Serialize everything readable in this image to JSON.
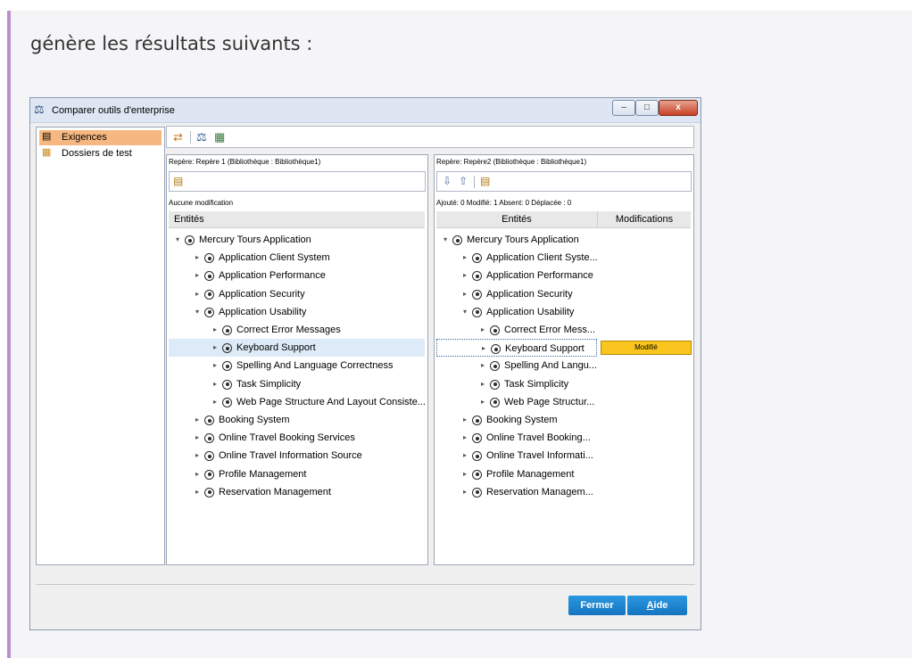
{
  "intro_text": "génère les résultats suivants :",
  "window": {
    "title": "Comparer outils d'enterprise",
    "title_icon": "balance-icon",
    "minimize": "–",
    "maximize": "□",
    "close": "x"
  },
  "sidebar": {
    "items": [
      {
        "label": "Exigences",
        "icon": "requirements-icon",
        "selected": true
      },
      {
        "label": "Dossiers de test",
        "icon": "test-folders-icon",
        "selected": false
      }
    ]
  },
  "toolbar": {
    "icons": [
      "compare-icon",
      "balance-icon",
      "grid-icon"
    ]
  },
  "left_panel": {
    "label": "Repère: Repère 1 (Bibliothèque : Bibliothèque1)",
    "status": "Aucune modification",
    "header_entites": "Entités",
    "tree": [
      {
        "label": "Mercury Tours Application",
        "level": 0,
        "expanded": true
      },
      {
        "label": "Application Client System",
        "level": 1,
        "expanded": false
      },
      {
        "label": "Application Performance",
        "level": 1,
        "expanded": false
      },
      {
        "label": "Application Security",
        "level": 1,
        "expanded": false
      },
      {
        "label": "Application Usability",
        "level": 1,
        "expanded": true
      },
      {
        "label": "Correct Error Messages",
        "level": 2,
        "expanded": false
      },
      {
        "label": "Keyboard Support",
        "level": 2,
        "expanded": false,
        "selected": true
      },
      {
        "label": "Spelling And Language Correctness",
        "level": 2,
        "expanded": false
      },
      {
        "label": "Task Simplicity",
        "level": 2,
        "expanded": false
      },
      {
        "label": "Web Page Structure And Layout Consiste...",
        "level": 2,
        "expanded": false
      },
      {
        "label": "Booking System",
        "level": 1,
        "expanded": false
      },
      {
        "label": "Online Travel Booking Services",
        "level": 1,
        "expanded": false
      },
      {
        "label": "Online Travel Information Source",
        "level": 1,
        "expanded": false
      },
      {
        "label": "Profile Management",
        "level": 1,
        "expanded": false
      },
      {
        "label": "Reservation Management",
        "level": 1,
        "expanded": false
      }
    ]
  },
  "right_panel": {
    "label": "Repère: Repère2 (Bibliothèque : Bibliothèque1)",
    "status": "Ajouté: 0 Modifié: 1 Absent: 0 Déplacée : 0",
    "header_entites": "Entités",
    "header_modifications": "Modifications",
    "tree": [
      {
        "label": "Mercury Tours Application",
        "level": 0,
        "expanded": true
      },
      {
        "label": "Application Client Syste...",
        "level": 1,
        "expanded": false
      },
      {
        "label": "Application Performance",
        "level": 1,
        "expanded": false
      },
      {
        "label": "Application Security",
        "level": 1,
        "expanded": false
      },
      {
        "label": "Application Usability",
        "level": 1,
        "expanded": true
      },
      {
        "label": "Correct Error Mess...",
        "level": 2,
        "expanded": false
      },
      {
        "label": "Keyboard Support",
        "level": 2,
        "expanded": false,
        "selected": true,
        "modification": "Modifié"
      },
      {
        "label": "Spelling And Langu...",
        "level": 2,
        "expanded": false
      },
      {
        "label": "Task Simplicity",
        "level": 2,
        "expanded": false
      },
      {
        "label": "Web Page Structur...",
        "level": 2,
        "expanded": false
      },
      {
        "label": "Booking System",
        "level": 1,
        "expanded": false
      },
      {
        "label": "Online Travel Booking...",
        "level": 1,
        "expanded": false
      },
      {
        "label": "Online Travel Informati...",
        "level": 1,
        "expanded": false
      },
      {
        "label": "Profile Management",
        "level": 1,
        "expanded": false
      },
      {
        "label": "Reservation Managem...",
        "level": 1,
        "expanded": false
      }
    ]
  },
  "buttons": {
    "fermer": "Fermer",
    "aide_first": "A",
    "aide_rest": "ide"
  },
  "colors": {
    "accent_bar": "#b98fd0",
    "sidebar_selected": "#f7b780",
    "modified_badge": "#f9c51e",
    "button_blue": "#1e88d6"
  }
}
